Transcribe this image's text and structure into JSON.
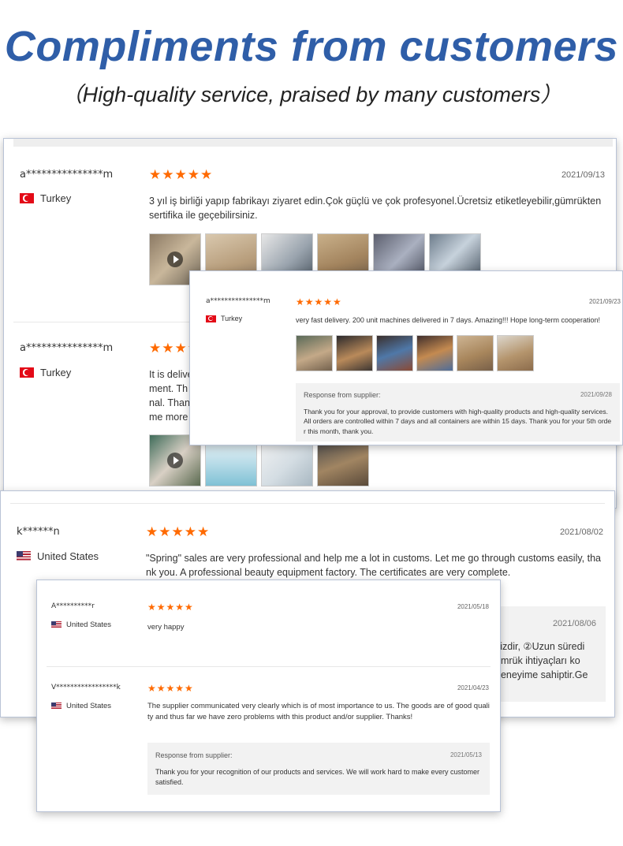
{
  "header": {
    "title": "Compliments from customers",
    "subtitle": "（High-quality service, praised by many customers）"
  },
  "colors": {
    "title": "#2f5ea8",
    "stars": "#ff6a00",
    "card_border": "#b9c3d6"
  },
  "stars": "★★★★★",
  "card1": {
    "review1": {
      "user": "a***************m",
      "country": "Turkey",
      "date": "2021/09/13",
      "text": "3 yıl iş birliği yapıp fabrikayı ziyaret edin.Çok güçlü ve çok profesyonel.Ücretsiz etiketleyebilir,gümrükten sertifika ile geçebilirsiniz."
    },
    "review2": {
      "user": "a***************m",
      "country": "Turkey",
      "text_lines": [
        "It is delive",
        "ment. Th",
        "nal. Than",
        "me more"
      ]
    }
  },
  "popup1": {
    "user": "a***************m",
    "country": "Turkey",
    "date": "2021/09/23",
    "text": "very fast delivery. 200 unit machines delivered in 7 days. Amazing!!! Hope long-term cooperation!",
    "response": {
      "title": "Response from supplier:",
      "date": "2021/09/28",
      "text": "Thank you for your approval, to provide customers with high-quality products and high-quality services. All orders are controlled within 7 days and all containers are within 15 days. Thank you for your 5th order this month, thank you."
    }
  },
  "card2": {
    "user": "k******n",
    "country": "United States",
    "date": "2021/08/02",
    "text": "\"Spring\" sales are very professional and help me a lot in customs. Let me go through customs easily, thank you. A professional beauty equipment factory. The certificates are very complete.",
    "partial_response": {
      "date": "2021/08/06",
      "lines": [
        "sizdir, ②Uzun süredi",
        "ümrük ihtiyaçları ko",
        "deneyime sahiptir.Ge"
      ]
    }
  },
  "popup2": {
    "review1": {
      "user": "A**********r",
      "country": "United States",
      "date": "2021/05/18",
      "text": "very happy"
    },
    "review2": {
      "user": "V*****************k",
      "country": "United States",
      "date": "2021/04/23",
      "text": "The supplier communicated very clearly which is of most importance to us. The goods are of good quality and thus far we have zero problems with this product and/or supplier. Thanks!",
      "response": {
        "title": "Response from supplier:",
        "date": "2021/05/13",
        "text": "Thank you for your recognition of our products and services. We will work hard to make every customer satisfied."
      }
    }
  }
}
